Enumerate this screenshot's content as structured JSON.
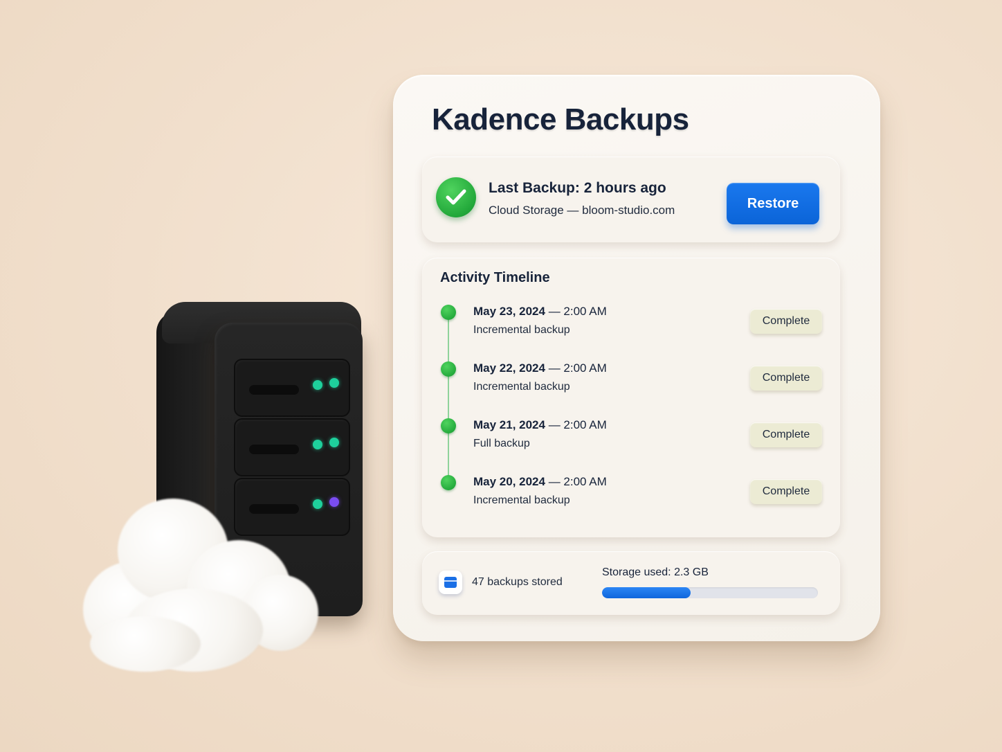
{
  "app": {
    "title": "Kadence Backups"
  },
  "status": {
    "headline": "Last Backup: 2 hours ago",
    "destination": "Cloud Storage — bloom-studio.com",
    "icon": "check-icon",
    "restore_label": "Restore"
  },
  "timeline": {
    "title": "Activity Timeline",
    "entries": [
      {
        "day": "May 23, 2024",
        "time": " — 2:00 AM",
        "type": "Incremental backup",
        "status": "Complete"
      },
      {
        "day": "May 22, 2024",
        "time": " — 2:00 AM",
        "type": "Incremental backup",
        "status": "Complete"
      },
      {
        "day": "May 21, 2024",
        "time": " — 2:00 AM",
        "type": "Full backup",
        "status": "Complete"
      },
      {
        "day": "May 20, 2024",
        "time": " — 2:00 AM",
        "type": "Incremental backup",
        "status": "Complete"
      }
    ]
  },
  "footer": {
    "icon": "database-icon",
    "backups_stored": "47 backups stored",
    "storage_label": "Storage used: 2.3 GB",
    "storage_fraction": 0.41
  },
  "colors": {
    "accent": "#0b64d8",
    "success": "#22a83a",
    "badge": "#ecebd4",
    "title": "#17233a"
  }
}
